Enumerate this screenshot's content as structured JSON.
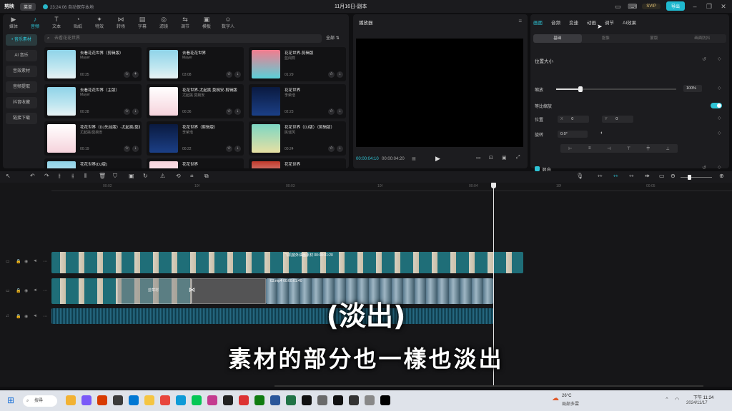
{
  "titlebar": {
    "logo": "剪映",
    "menu": "菜单",
    "autosave": "23:24:06 自动保存本地",
    "title": "11月16日-副本",
    "svip": "SVIP",
    "export": "导出"
  },
  "media": {
    "tabs": [
      "媒体",
      "音频",
      "文本",
      "贴纸",
      "特效",
      "转场",
      "字幕",
      "滤镜",
      "调节",
      "模板",
      "数字人"
    ],
    "tab_icons": [
      "▶",
      "♪",
      "T",
      "◔",
      "✦",
      "⋈",
      "▤",
      "◎",
      "⇆",
      "▣",
      "☺"
    ],
    "active_tab": 1,
    "sidebar": [
      "• 音乐素材",
      "AI 音乐",
      "音效素材",
      "音频提取",
      "抖音收藏",
      "链接下载"
    ],
    "search_placeholder": "去看花花世界",
    "filter_label": "全部",
    "cards": [
      {
        "title": "去看花花世界（剪辑版）",
        "artist": "Mayer",
        "duration": "00:35"
      },
      {
        "title": "去看花花世界",
        "artist": "Mayer",
        "duration": "03:08"
      },
      {
        "title": "花花世界-剪辑版",
        "artist": "蓝闻燕",
        "duration": "01:29"
      },
      {
        "title": "去看花花世界（主版）",
        "artist": "Mayer",
        "duration": "00:28"
      },
      {
        "title": "花花世界-尤起挑 莫婉安-剪辑版",
        "artist": "尤起挑 莫婉安",
        "duration": "00:36"
      },
      {
        "title": "花花世界",
        "artist": "李荣浩",
        "duration": "02:23"
      },
      {
        "title": "花花世界（DJ先挂版）-尤起挑/莫婉安-剪辑版",
        "artist": "尤起挑/莫婉安",
        "duration": "00:19"
      },
      {
        "title": "花花世界（剪辑版）",
        "artist": "李荣浩",
        "duration": "00:22"
      },
      {
        "title": "花花世界（DJ版）（剪辑版）",
        "artist": "民谣风",
        "duration": "00:24"
      },
      {
        "title": "花花世界(DJ版)",
        "artist": "",
        "duration": ""
      },
      {
        "title": "花花世界",
        "artist": "",
        "duration": ""
      },
      {
        "title": "花花世界",
        "artist": "",
        "duration": ""
      }
    ]
  },
  "player": {
    "title": "播放器",
    "time_current": "00:00:04:10",
    "time_total": "00:00:04:20"
  },
  "props": {
    "tabs": [
      "画面",
      "音频",
      "变速",
      "动画",
      "调节",
      "AI效果"
    ],
    "active_tab": 0,
    "subtabs": [
      "基础",
      "抠像",
      "蒙版",
      "画面防抖"
    ],
    "active_subtab": 0,
    "section_position_size": "位置大小",
    "scale_label": "缩放",
    "scale_value": "100%",
    "scale_fraction": 0.2,
    "uniform_scale_label": "等比缩放",
    "position_label": "位置",
    "pos_x_label": "X",
    "pos_x": "0",
    "pos_y_label": "Y",
    "pos_y": "0",
    "rotate_label": "旋转",
    "rotate_value": "0.0°",
    "blend_label": "混合"
  },
  "timeline": {
    "ruler_ticks": [
      "00:02",
      "10f",
      "00:03",
      "10f",
      "00:04",
      "10f",
      "00:05"
    ],
    "overlay_clip_label": "飞机窗外油画素材 00:00:01:20",
    "main_clip_label": "03.mp4  00:00:01:40",
    "ghost_clip_label": "蓝莓材"
  },
  "captions": {
    "line1": "(淡出)",
    "line2": "素材的部分也一樣也淡出"
  },
  "taskbar": {
    "search": "搜尋",
    "temp": "26°C",
    "weather": "局部多雲",
    "time": "下午 11:24",
    "date": "2024/11/17"
  }
}
